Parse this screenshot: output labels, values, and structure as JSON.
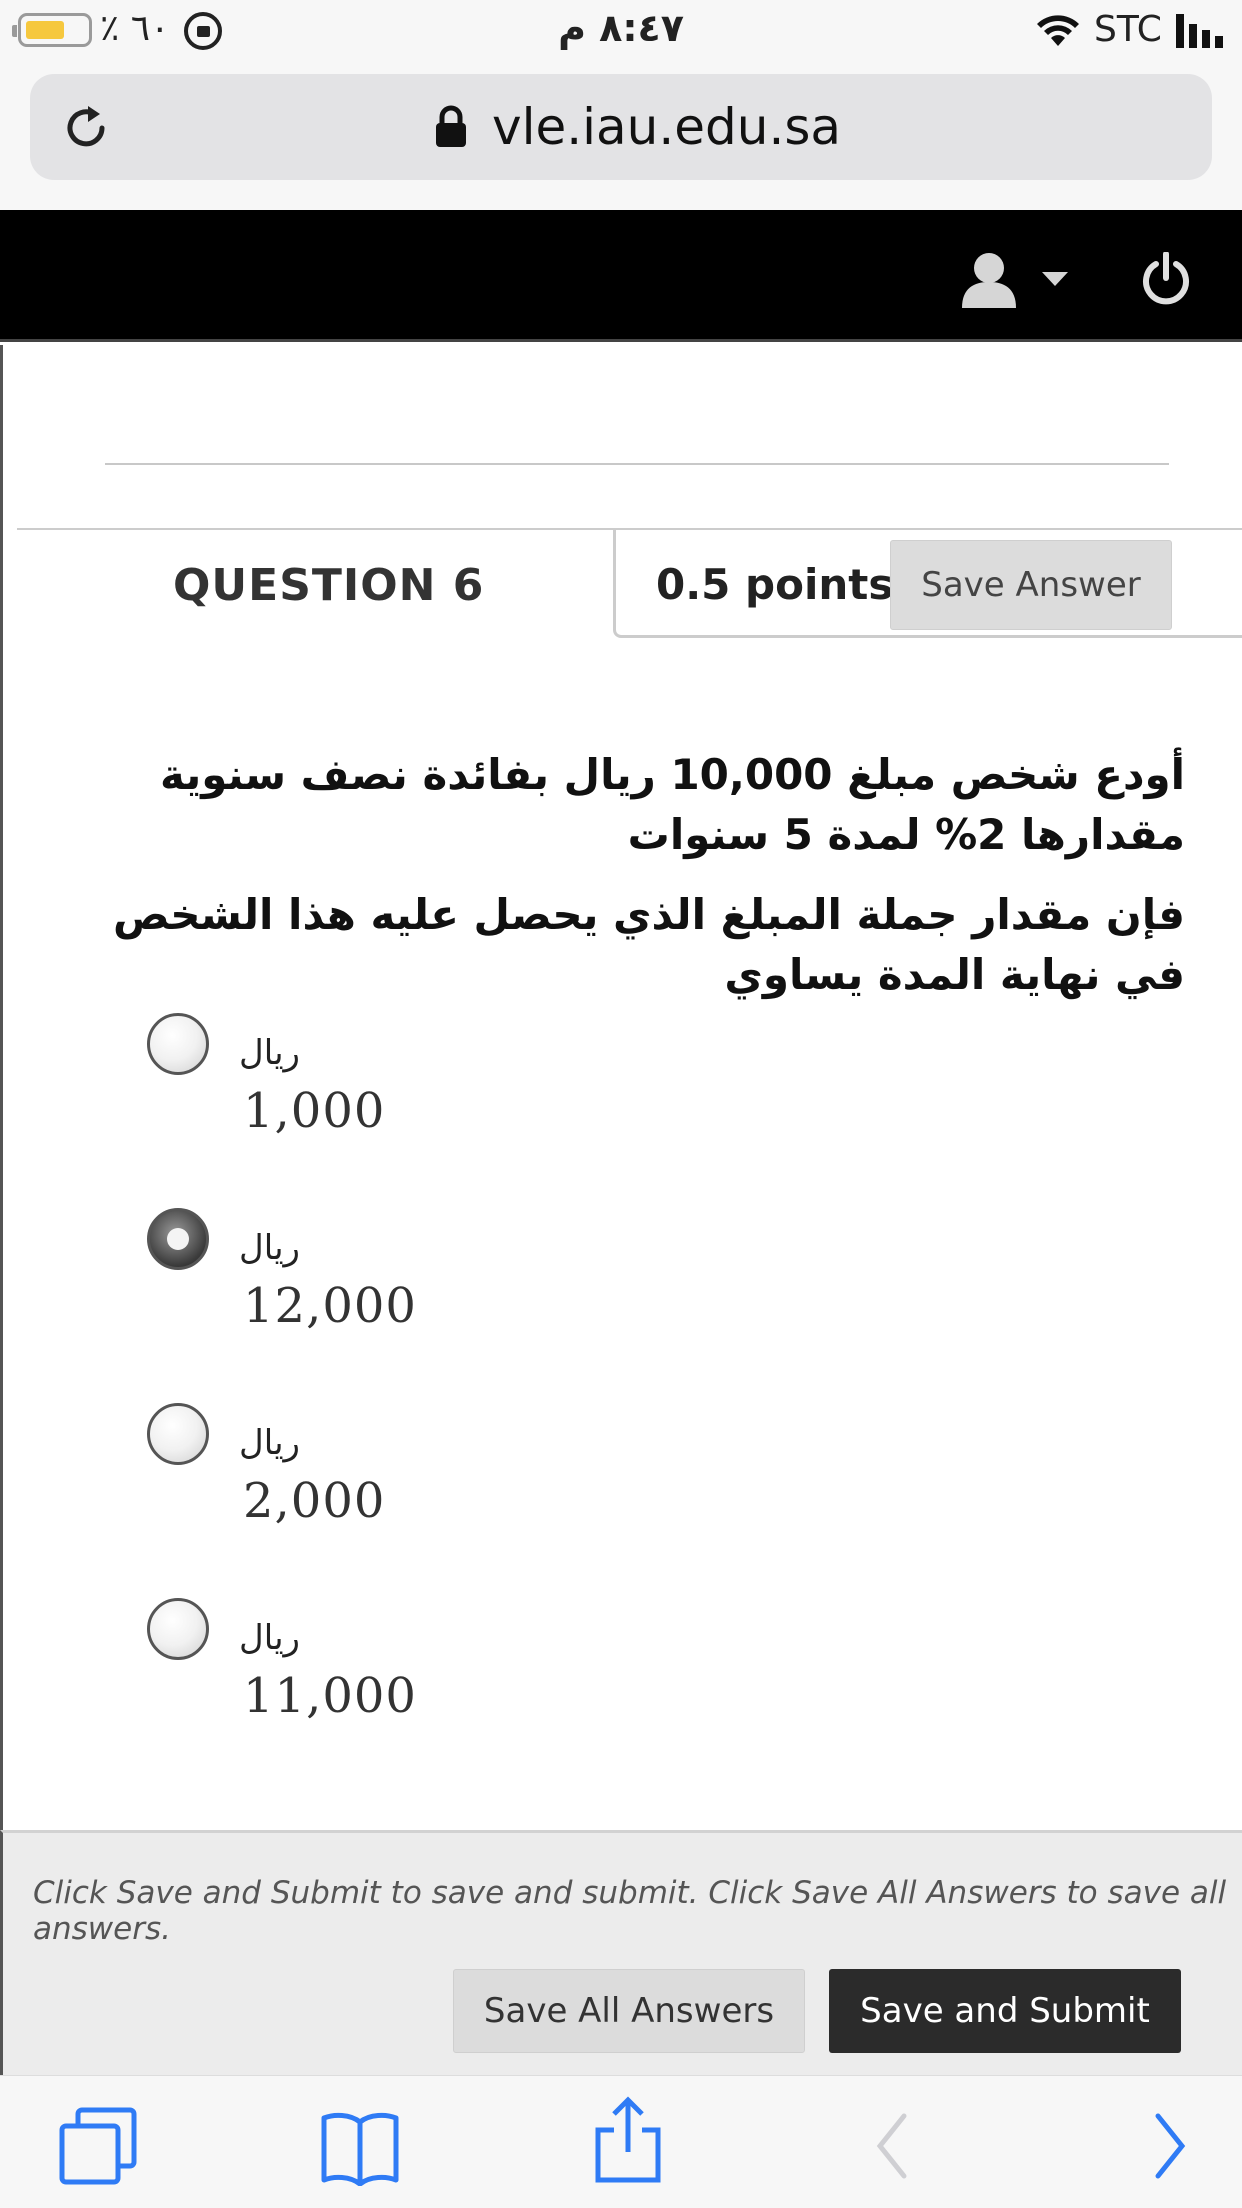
{
  "status_bar": {
    "battery_percent": "٪ ٦٠",
    "time": "٨:٤٧ م",
    "carrier": "STC",
    "battery_level": 0.6
  },
  "browser": {
    "url": "vle.iau.edu.sa"
  },
  "question": {
    "title": "QUESTION 6",
    "points": "0.5 points",
    "save_answer_label": "Save Answer",
    "text_line1": "أودع شخص مبلغ 10,000 ريال بفائدة نصف سنوية مقدارها 2%  لمدة 5 سنوات",
    "text_line2": "فإن مقدار جملة المبلغ الذي يحصل عليه هذا الشخص في نهاية المدة يساوي",
    "options": [
      {
        "currency": "ريال",
        "amount": "1,000",
        "selected": false
      },
      {
        "currency": "ريال",
        "amount": "12,000",
        "selected": true
      },
      {
        "currency": "ريال",
        "amount": "2,000",
        "selected": false
      },
      {
        "currency": "ريال",
        "amount": "11,000",
        "selected": false
      }
    ]
  },
  "footer": {
    "note": "Click Save and Submit to save and submit. Click Save All Answers to save all answers.",
    "save_all_label": "Save All Answers",
    "save_submit_label": "Save and Submit"
  },
  "colors": {
    "nav_background": "#000000",
    "toolbar_accent": "#2f7bf5",
    "submit_button": "#2b2b2b",
    "battery_fill": "#f6c83e"
  },
  "icons": [
    "battery-icon",
    "rotation-lock-icon",
    "wifi-icon",
    "signal-icon",
    "reload-icon",
    "lock-icon",
    "user-icon",
    "caret-down-icon",
    "power-icon",
    "tabs-icon",
    "bookmarks-icon",
    "share-icon",
    "back-icon",
    "forward-icon"
  ]
}
